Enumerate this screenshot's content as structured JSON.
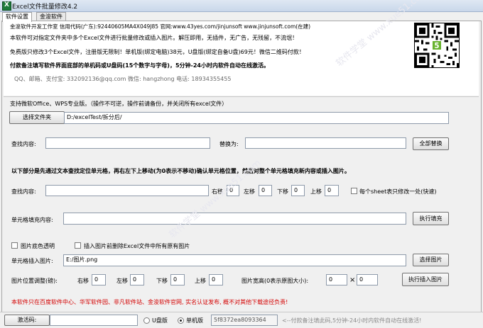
{
  "window": {
    "title": "Excel文件批量修改4.2"
  },
  "tabs": [
    {
      "label": "软件设置"
    },
    {
      "label": "金浚软件"
    }
  ],
  "info": {
    "line1": "金浚软件开发工作室 信用代码(广东):92440605MA4X049J85 官网:www.43yes.com/jinjunsoft  www.jinjunsoft.com(在建)",
    "line2": "本软件可对指定文件夹中多个Excel文件进行批量修改或插入图片。解压即用，无插件，无广告，无残留，不流氓！",
    "line3": "免费版只修改3个Excel文件，注册版无限制！单机版(绑定电脑)38元，U盘版(绑定自备U盘)69元！微信二维码付款！",
    "line4": "付款备注填写软件界面底部的单机码或U盘码(15个数字与字母)，5分钟-24小时内软件自动在线激活。",
    "line5": "QQ、邮箱、支付宝: 332092136@qq.com    微信: hangzhong    电话: 18934355455"
  },
  "support_text": "支持微软Office、WPS专业版。（操作不可逆，操作前请备份，并关闭所有excel文件）",
  "folder": {
    "button": "选择文件夹",
    "path": "D:/excelTest/拆分后/"
  },
  "replace": {
    "find_label": "查找内容:",
    "find_value": "",
    "replace_label": "替换为:",
    "replace_value": "",
    "button": "全部替换"
  },
  "section_note": "以下部分是先通过文本查找定位单元格，再右左下上移动(为0表示不移动)确认单元格位置，然后对整个单元格填充新内容或插入图片。",
  "locate": {
    "find_label": "查找内容:",
    "find_value": "",
    "right_label": "右移",
    "right_value": "0",
    "left_label": "左移",
    "left_value": "0",
    "down_label": "下移",
    "down_value": "0",
    "up_label": "上移",
    "up_value": "0",
    "sheet_label": "每个sheet表只修改一处(快速)"
  },
  "fill": {
    "label": "单元格填充内容:",
    "value": "",
    "button": "执行填充"
  },
  "options": {
    "transparent_label": "图片底色透明",
    "delete_label": "插入图片前删除Excel文件中所有原有图片"
  },
  "image": {
    "label": "单元格插入图片:",
    "path": "E:/图片.png",
    "button": "选择图片"
  },
  "image_pos": {
    "label": "图片位置调整(磅):",
    "right_label": "右移",
    "right_value": "0",
    "left_label": "左移",
    "left_value": "0",
    "down_label": "下移",
    "down_value": "0",
    "up_label": "上移",
    "up_value": "0",
    "size_label": "图片宽高(0表示原图大小):",
    "width_value": "0",
    "times": "×",
    "height_value": "0",
    "button": "执行插入图片"
  },
  "footer_notice": "本软件只在百度软件中心、华军软件园、非凡软件站、金浚软件官网, 实名认证发布, 概不对其他下载途径负责!",
  "status": {
    "activate_label": "激活码:",
    "activate_value": "",
    "udisk_label": "U盘版",
    "single_label": "单机版",
    "machine_code": "5f8372ea8093364",
    "hint": "<--付款备注填此码,5分钟-24小时内软件自动在线激活!"
  },
  "watermark": "软件学堂 www.xue51.com"
}
